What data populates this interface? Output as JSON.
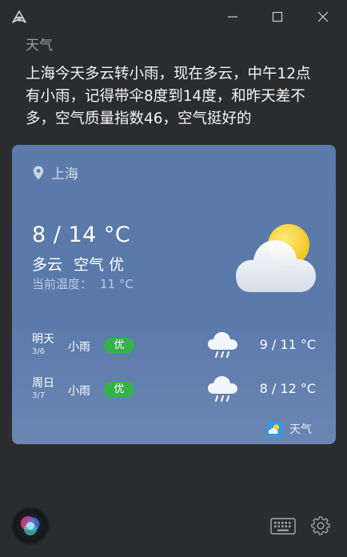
{
  "window": {
    "app_icon": "app-logo-icon",
    "controls": [
      "minimize-icon",
      "maximize-icon",
      "close-icon"
    ]
  },
  "skill_label": "天气",
  "answer": "上海今天多云转小雨，现在多云，中午12点有小雨，记得带伞8度到14度，和昨天差不多，空气质量指数46，空气挺好的",
  "weather_card": {
    "location": "上海",
    "temp_range": "8 / 14 °C",
    "condition": "多云",
    "air_quality": "空气 优",
    "current_label": "当前温度：",
    "current_value": "11 °C",
    "main_icon": "partly-cloudy-icon",
    "forecast": [
      {
        "day": "明天",
        "date": "3/6",
        "condition": "小雨",
        "aqi": "优",
        "icon": "light-rain-icon",
        "temp": "9 / 11 °C"
      },
      {
        "day": "周日",
        "date": "3/7",
        "condition": "小雨",
        "aqi": "优",
        "icon": "light-rain-icon",
        "temp": "8 / 12 °C"
      }
    ],
    "source": "天气",
    "source_icon": "weather-app-icon",
    "colors": {
      "card": "#5c7bab",
      "badge": "#36b24a"
    }
  },
  "footer": {
    "icons": [
      "assistant-orb-icon",
      "keyboard-icon",
      "gear-icon"
    ]
  }
}
